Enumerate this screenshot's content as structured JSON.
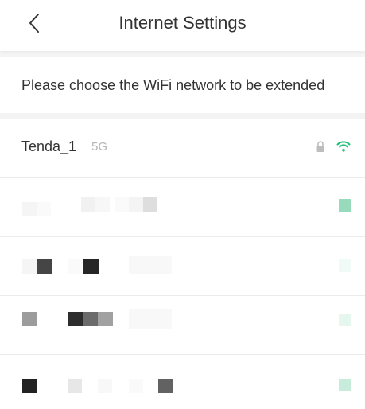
{
  "header": {
    "title": "Internet Settings",
    "back_icon": "chevron-left-icon"
  },
  "instruction_text": "Please choose the WiFi network to be extended",
  "networks": [
    {
      "name": "Tenda_1",
      "band": "5G",
      "lock_icon": "lock-icon",
      "signal_icon": "wifi-icon"
    }
  ],
  "colors": {
    "wifi_signal": "#21c07a",
    "text_primary": "#333333",
    "text_secondary": "#b5b5b5",
    "divider": "#ececec"
  }
}
